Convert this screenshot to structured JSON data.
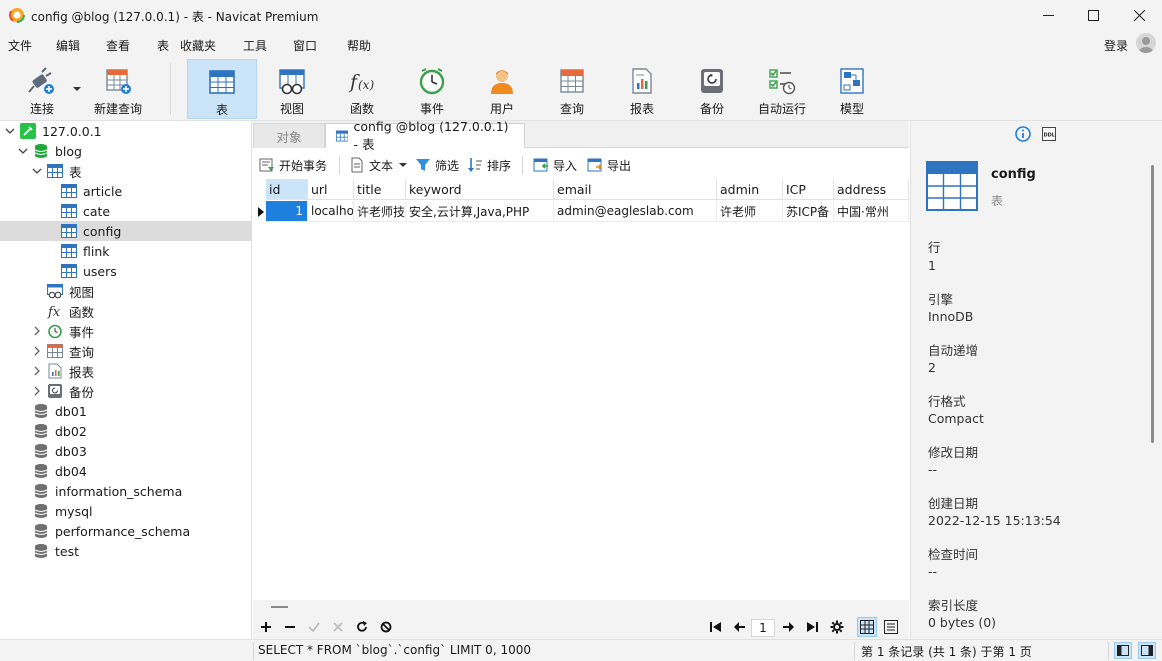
{
  "window": {
    "title": "config @blog (127.0.0.1) - 表 - Navicat Premium"
  },
  "menu": {
    "items": [
      "文件",
      "编辑",
      "查看",
      "表",
      "收藏夹",
      "工具",
      "窗口",
      "帮助"
    ],
    "login": "登录"
  },
  "toolbar": {
    "items": [
      {
        "label": "连接",
        "icon": "plug-icon"
      },
      {
        "label": "新建查询",
        "icon": "new-query-icon"
      },
      {
        "label": "表",
        "icon": "table-icon",
        "active": true
      },
      {
        "label": "视图",
        "icon": "view-icon"
      },
      {
        "label": "函数",
        "icon": "function-icon"
      },
      {
        "label": "事件",
        "icon": "clock-icon"
      },
      {
        "label": "用户",
        "icon": "user-icon"
      },
      {
        "label": "查询",
        "icon": "query-icon"
      },
      {
        "label": "报表",
        "icon": "report-icon"
      },
      {
        "label": "备份",
        "icon": "backup-icon"
      },
      {
        "label": "自动运行",
        "icon": "automation-icon"
      },
      {
        "label": "模型",
        "icon": "model-icon"
      }
    ]
  },
  "tree": {
    "connection": "127.0.0.1",
    "database": "blog",
    "tables_label": "表",
    "tables": [
      "article",
      "cate",
      "config",
      "flink",
      "users"
    ],
    "selected_table": "config",
    "groups": [
      "视图",
      "函数",
      "事件",
      "查询",
      "报表",
      "备份"
    ],
    "other_databases": [
      "db01",
      "db02",
      "db03",
      "db04",
      "information_schema",
      "mysql",
      "performance_schema",
      "test"
    ]
  },
  "tabs": {
    "objects": "对象",
    "active": "config @blog (127.0.0.1) - 表"
  },
  "subtoolbar": {
    "begin_transaction": "开始事务",
    "text": "文本",
    "filter": "筛选",
    "sort": "排序",
    "import": "导入",
    "export": "导出"
  },
  "grid": {
    "columns": [
      "id",
      "url",
      "title",
      "keyword",
      "email",
      "admin",
      "ICP",
      "address"
    ],
    "rows": [
      [
        "1",
        "localho",
        "许老师技",
        "安全,云计算,Java,PHP",
        "admin@eagleslab.com",
        "许老师",
        "苏ICP备",
        "中国·常州"
      ]
    ],
    "page": "1"
  },
  "info": {
    "name": "config",
    "type": "表",
    "fields": [
      {
        "label": "行",
        "value": "1"
      },
      {
        "label": "引擎",
        "value": "InnoDB"
      },
      {
        "label": "自动递增",
        "value": "2"
      },
      {
        "label": "行格式",
        "value": "Compact"
      },
      {
        "label": "修改日期",
        "value": "--"
      },
      {
        "label": "创建日期",
        "value": "2022-12-15 15:13:54"
      },
      {
        "label": "检查时间",
        "value": "--"
      },
      {
        "label": "索引长度",
        "value": "0 bytes (0)"
      }
    ]
  },
  "status": {
    "sql": "SELECT * FROM `blog`.`config` LIMIT 0, 1000",
    "records": "第 1 条记录 (共 1 条) 于第 1 页"
  }
}
